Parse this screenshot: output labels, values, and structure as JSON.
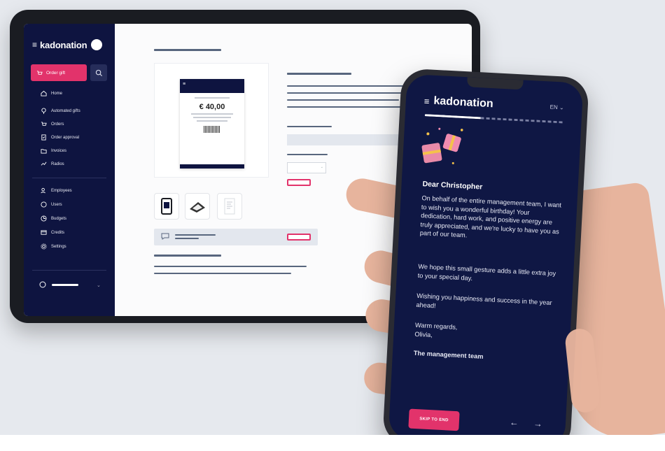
{
  "colors": {
    "navy": "#0e1440",
    "accent": "#e2336b",
    "background": "#e6e9ee"
  },
  "tablet": {
    "brand": "kadonation",
    "sidebar": {
      "order_gift": "Order gift",
      "items": [
        {
          "label": "Home",
          "icon": "home-icon"
        },
        {
          "label": "Automated gifts",
          "icon": "automation-icon"
        },
        {
          "label": "Orders",
          "icon": "cart-icon"
        },
        {
          "label": "Order approval",
          "icon": "approval-icon"
        },
        {
          "label": "Invoices",
          "icon": "folder-icon"
        },
        {
          "label": "Radios",
          "icon": "radio-icon"
        }
      ],
      "items2": [
        {
          "label": "Employees",
          "icon": "people-icon"
        },
        {
          "label": "Users",
          "icon": "user-icon"
        },
        {
          "label": "Budgets",
          "icon": "budget-icon"
        },
        {
          "label": "Credits",
          "icon": "credit-card-icon"
        },
        {
          "label": "Settings",
          "icon": "gear-icon"
        }
      ]
    },
    "product": {
      "voucher_amount": "€ 40,00"
    }
  },
  "phone": {
    "brand": "kadonation",
    "language": "EN",
    "greeting": "Dear Christopher",
    "paragraphs": [
      "On behalf of the entire management team, I want to wish you a wonderful birthday! Your dedication, hard work, and positive energy are truly appreciated, and we're lucky to have you as part of our team.",
      "We hope this small gesture adds a little extra joy to your special day.",
      "Wishing you happiness and success in the year ahead!"
    ],
    "closing": "Warm regards,",
    "signature": "Olivia,",
    "team": "The management team",
    "skip_label": "SKIP TO END",
    "prev_arrow": "←",
    "next_arrow": "→"
  }
}
